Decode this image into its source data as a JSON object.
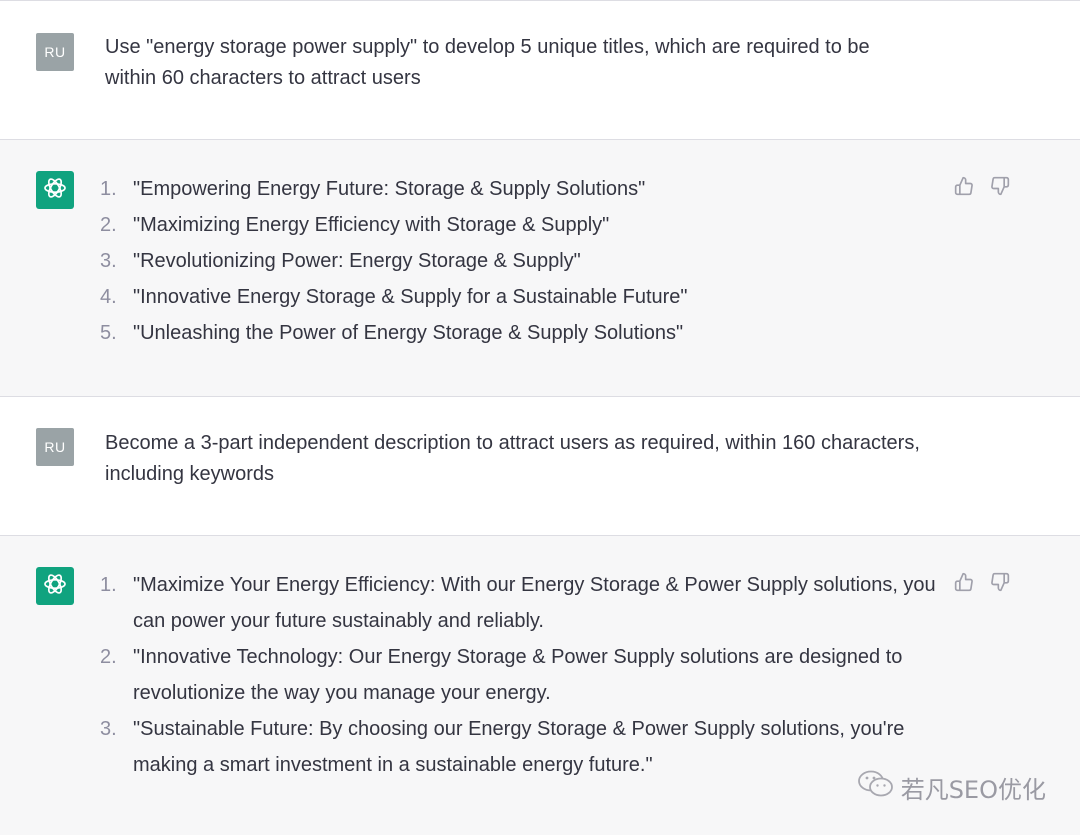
{
  "messages": [
    {
      "role": "user",
      "avatar_label": "RU",
      "text": "Use \"energy storage power supply\" to develop 5 unique titles, which are required to be within 60 characters to attract users"
    },
    {
      "role": "assistant",
      "items": [
        {
          "num": "1.",
          "text": "\"Empowering Energy Future: Storage & Supply Solutions\""
        },
        {
          "num": "2.",
          "text": "\"Maximizing Energy Efficiency with Storage & Supply\""
        },
        {
          "num": "3.",
          "text": "\"Revolutionizing Power: Energy Storage & Supply\""
        },
        {
          "num": "4.",
          "text": "\"Innovative Energy Storage & Supply for a Sustainable Future\""
        },
        {
          "num": "5.",
          "text": "\"Unleashing the Power of Energy Storage & Supply Solutions\""
        }
      ]
    },
    {
      "role": "user",
      "avatar_label": "RU",
      "text": "Become a 3-part independent description to attract users as required, within 160 characters, including keywords"
    },
    {
      "role": "assistant",
      "items": [
        {
          "num": "1.",
          "text": "\"Maximize Your Energy Efficiency: With our Energy Storage & Power Supply solutions, you can power your future sustainably and reliably."
        },
        {
          "num": "2.",
          "text": "\"Innovative Technology: Our Energy Storage & Power Supply solutions are designed to revolutionize the way you manage your energy."
        },
        {
          "num": "3.",
          "text": "\"Sustainable Future: By choosing our Energy Storage & Power Supply solutions, you're making a smart investment in a sustainable energy future.\""
        }
      ]
    }
  ],
  "icons": {
    "bot_avatar": "openai-logo-icon",
    "thumbs_up": "thumbs-up-icon",
    "thumbs_down": "thumbs-down-icon",
    "watermark": "wechat-icon"
  },
  "watermark": {
    "text": "若凡SEO优化"
  },
  "colors": {
    "assistant_bg": "#f7f7f8",
    "user_avatar_bg": "#9aa3a6",
    "bot_avatar_bg": "#10a37f",
    "text": "#343541",
    "number": "#8e8ea0"
  }
}
